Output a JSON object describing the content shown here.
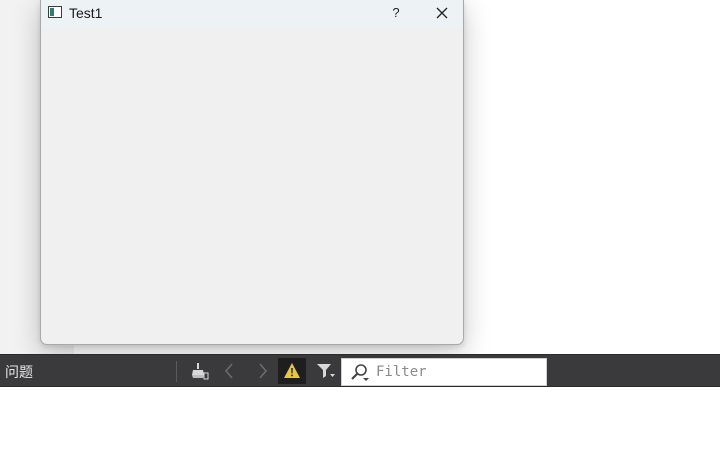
{
  "dialog": {
    "title": "Test1",
    "help_label": "?",
    "app_icon": "window-app-icon",
    "close_icon": "close-icon"
  },
  "panel": {
    "label": "问题",
    "buttons": [
      {
        "icon": "clear-broom-icon"
      },
      {
        "icon": "chevron-left-icon"
      },
      {
        "icon": "chevron-right-icon"
      },
      {
        "icon": "warning-icon",
        "active": true
      },
      {
        "icon": "filter-funnel-icon"
      }
    ],
    "filter": {
      "placeholder": "Filter",
      "value": "",
      "icon": "search-icon"
    }
  },
  "colors": {
    "toolbar_bg": "#3a3a3c",
    "dialog_bg": "#f0f0f0",
    "titlebar_bg": "#edf2f5",
    "warning": "#e8c547"
  }
}
